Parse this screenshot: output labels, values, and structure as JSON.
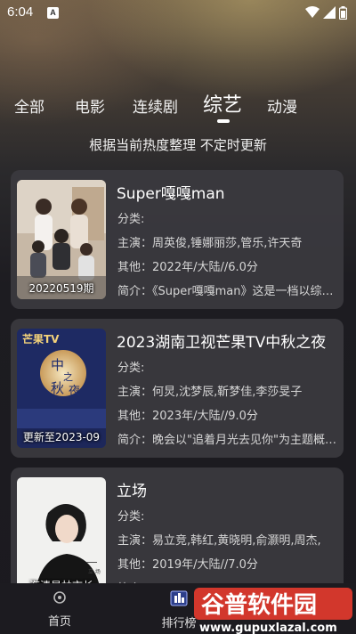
{
  "status_bar": {
    "time": "6:04",
    "notification_letter": "A"
  },
  "tabs": [
    {
      "label": "全部",
      "active": false
    },
    {
      "label": "电影",
      "active": false
    },
    {
      "label": "连续剧",
      "active": false
    },
    {
      "label": "综艺",
      "active": true
    },
    {
      "label": "动漫",
      "active": false
    }
  ],
  "subtitle": "根据当前热度整理 不定时更新",
  "cards": [
    {
      "title": "Super嘎嘎man",
      "category": "分类:",
      "cast": "主演：周英俊,锤娜丽莎,管乐,许天奇",
      "other": "其他：2022年/大陆//6.0分",
      "intro": "简介：《Super嘎嘎man》这是一档以综艺为基础的",
      "poster_caption": "20220519期"
    },
    {
      "title": "2023湖南卫视芒果TV中秋之夜",
      "category": "分类:",
      "cast": "主演：何炅,沈梦辰,靳梦佳,李莎旻子",
      "other": "其他：2023年/大陆//9.0分",
      "intro": "简介：晚会以\"追着月光去见你\"为主题概括了",
      "poster_caption": "更新至2023-09",
      "poster_logo": "芒果TV"
    },
    {
      "title": "立场",
      "category": "分类:",
      "cast": "主演：易立竞,韩红,黄晓明,俞灏明,周杰,",
      "other": "其他：2019年/大陆//7.0分",
      "intro": "简介：",
      "poster_caption": "海清是林市长"
    }
  ],
  "bottom_nav": {
    "home_label": "首页",
    "ranking_label": "排行榜"
  },
  "watermark": {
    "brand": "谷普软件园",
    "url": "www.gupuxlazal.com"
  },
  "colors": {
    "accent": "#ffffff",
    "card_bg": "#3a393e",
    "nav_bg": "#1c1b20"
  }
}
